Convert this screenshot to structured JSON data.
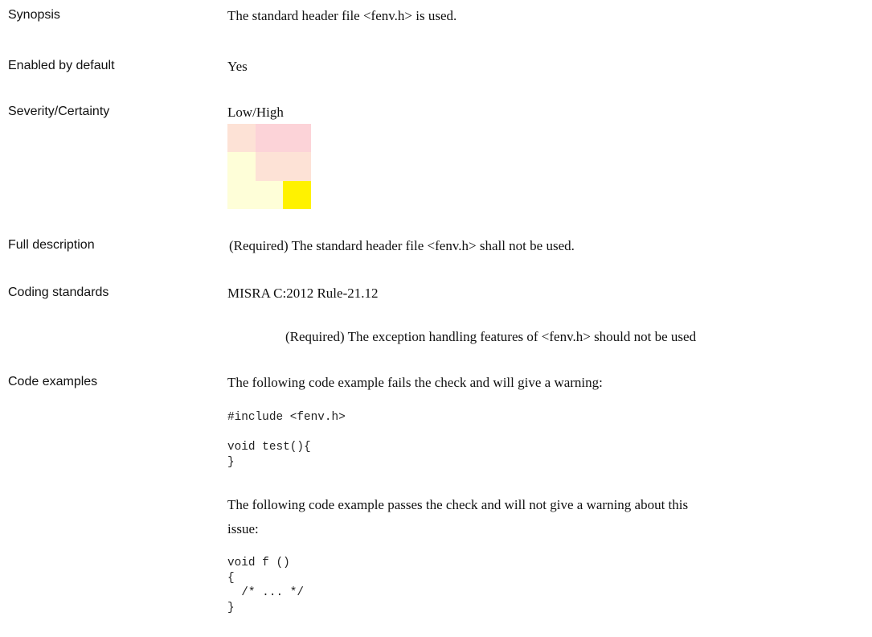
{
  "rows": {
    "synopsis": {
      "label": "Synopsis",
      "value": "The standard header file <fenv.h> is used."
    },
    "enabled": {
      "label": "Enabled by default",
      "value": "Yes"
    },
    "severity": {
      "label": "Severity/Certainty",
      "value": "Low/High"
    },
    "full_description": {
      "label": "Full description",
      "value": "(Required) The standard header file <fenv.h> shall not be used."
    },
    "coding_standards": {
      "label": "Coding standards",
      "standard": "MISRA C:2012 Rule-21.12",
      "standard_description": "(Required) The exception handling features of <fenv.h> should not be used"
    },
    "code_examples": {
      "label": "Code examples",
      "fail_intro": "The following code example fails the check and will give a warning:",
      "fail_code": "#include <fenv.h>\n\nvoid test(){\n}",
      "pass_intro_line1": "The following code example passes the check and will not give a warning about this",
      "pass_intro_line2": "issue:",
      "pass_code": "void f ()\n{\n  /* ... */\n}"
    }
  },
  "severity_matrix": {
    "colors": [
      [
        "#fde2d6",
        "#fcd3d8",
        "#fcd3d8"
      ],
      [
        "#fefed8",
        "#fde2d6",
        "#fde2d6"
      ],
      [
        "#fefed8",
        "#fefed8",
        "#fff200"
      ]
    ]
  }
}
